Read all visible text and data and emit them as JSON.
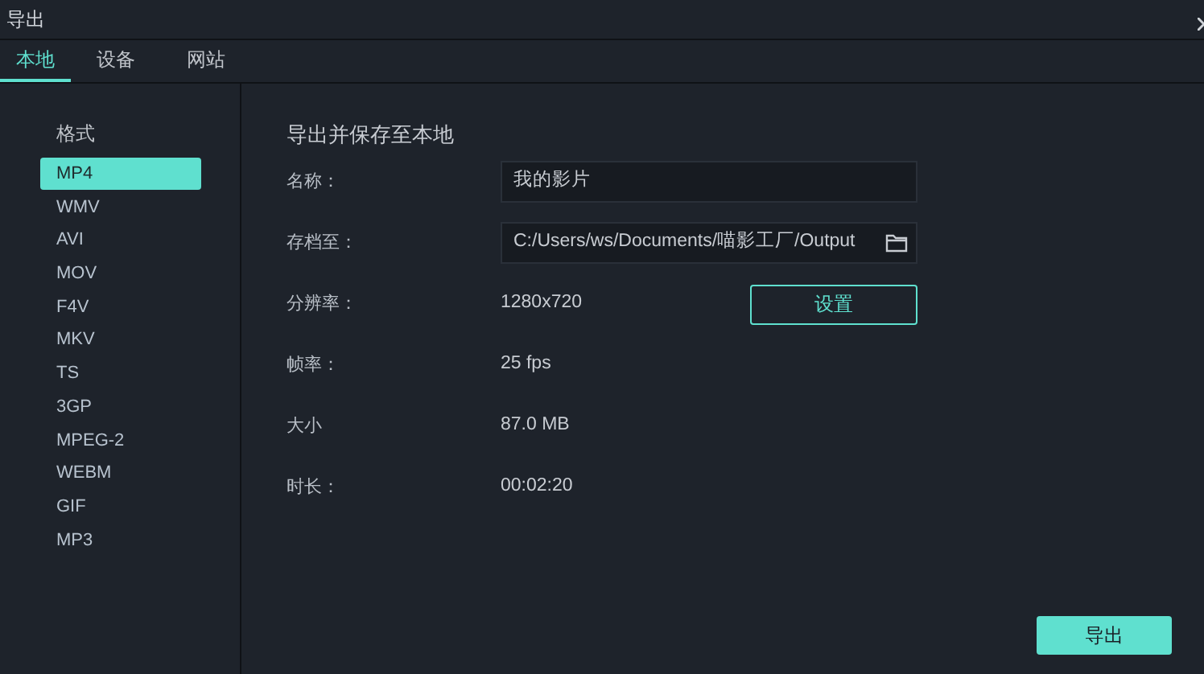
{
  "window": {
    "title": "导出"
  },
  "tabs": [
    {
      "label": "本地",
      "selected": true
    },
    {
      "label": "设备",
      "selected": false
    },
    {
      "label": "网站",
      "selected": false
    }
  ],
  "format_list": {
    "heading": "格式",
    "items": [
      {
        "label": "MP4",
        "selected": true
      },
      {
        "label": "WMV",
        "selected": false
      },
      {
        "label": "AVI",
        "selected": false
      },
      {
        "label": "MOV",
        "selected": false
      },
      {
        "label": "F4V",
        "selected": false
      },
      {
        "label": "MKV",
        "selected": false
      },
      {
        "label": "TS",
        "selected": false
      },
      {
        "label": "3GP",
        "selected": false
      },
      {
        "label": "MPEG-2",
        "selected": false
      },
      {
        "label": "WEBM",
        "selected": false
      },
      {
        "label": "GIF",
        "selected": false
      },
      {
        "label": "MP3",
        "selected": false
      }
    ]
  },
  "panel": {
    "title": "导出并保存至本地",
    "rows": [
      {
        "kind": "input",
        "label": "名称：",
        "value": "我的影片"
      },
      {
        "kind": "folder",
        "label": "存档至：",
        "value": "C:/Users/ws/Documents/喵影工厂/Output"
      },
      {
        "kind": "button",
        "label": "分辨率：",
        "value": "1280x720",
        "button": "设置"
      },
      {
        "kind": "text",
        "label": "帧率：",
        "value": "25 fps"
      },
      {
        "kind": "text",
        "label": "大小",
        "value": "87.0 MB"
      },
      {
        "kind": "text",
        "label": "时长：",
        "value": "00:02:20"
      }
    ]
  },
  "export_button": "导出"
}
